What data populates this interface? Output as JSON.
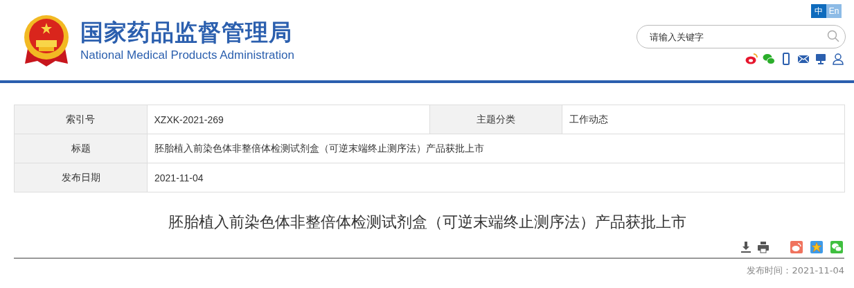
{
  "header": {
    "title": "国家药品监督管理局",
    "subtitle": "National Medical Products Administration"
  },
  "languages": [
    {
      "label": "中",
      "selected": true
    },
    {
      "label": "En",
      "selected": false
    }
  ],
  "search": {
    "placeholder": "请输入关键字"
  },
  "info_table": {
    "rows": [
      {
        "cells": [
          {
            "label": "索引号",
            "value": "XZXK-2021-269"
          },
          {
            "label": "主题分类",
            "value": "工作动态"
          }
        ]
      },
      {
        "cells": [
          {
            "label": "标题",
            "value": "胚胎植入前染色体非整倍体检测试剂盒（可逆末端终止测序法）产品获批上市"
          }
        ]
      },
      {
        "cells": [
          {
            "label": "发布日期",
            "value": "2021-11-04"
          }
        ]
      }
    ]
  },
  "article": {
    "title": "胚胎植入前染色体非整倍体检测试剂盒（可逆末端终止测序法）产品获批上市",
    "publish_label": "发布时间：",
    "publish_date": "2021-11-04"
  }
}
